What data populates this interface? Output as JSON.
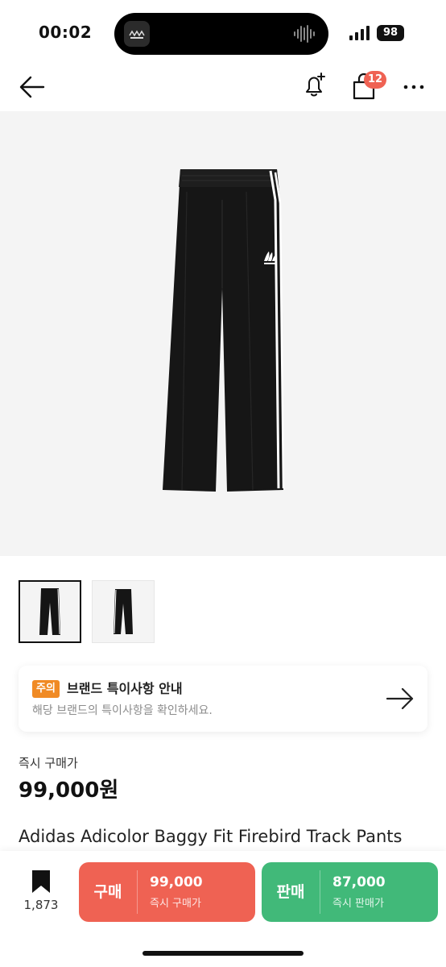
{
  "status_bar": {
    "time": "00:02",
    "battery": "98"
  },
  "header": {
    "cart_badge": "12"
  },
  "notice": {
    "tag": "주의",
    "title": "브랜드 특이사항 안내",
    "subtitle": "해당 브랜드의 특이사항을 확인하세요."
  },
  "pricing": {
    "label": "즉시 구매가",
    "price": "99,000원"
  },
  "product": {
    "title": "Adidas Adicolor Baggy Fit Firebird Track Pants"
  },
  "bottom_bar": {
    "bookmark_count": "1,873",
    "buy": {
      "label": "구매",
      "price": "99,000",
      "sub": "즉시 구매가"
    },
    "sell": {
      "label": "판매",
      "price": "87,000",
      "sub": "즉시 판매가"
    }
  },
  "colors": {
    "buy": "#ef6253",
    "sell": "#41b979",
    "notice_tag": "#f08a24",
    "badge": "#ef6253"
  }
}
